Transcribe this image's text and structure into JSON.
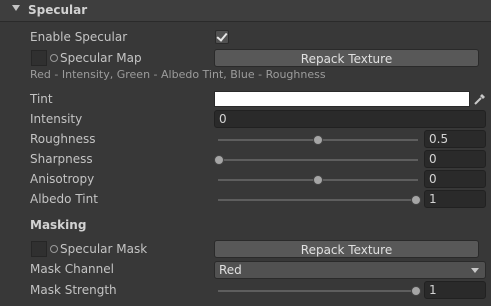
{
  "section": {
    "title": "Specular"
  },
  "enable_specular": {
    "label": "Enable Specular",
    "checked": true
  },
  "specular_map": {
    "label": "Specular Map",
    "button": "Repack Texture",
    "help": "Red - Intensity, Green - Albedo Tint, Blue - Roughness"
  },
  "tint": {
    "label": "Tint",
    "color": "#ffffff"
  },
  "intensity": {
    "label": "Intensity",
    "value": "0"
  },
  "roughness": {
    "label": "Roughness",
    "value": "0.5",
    "fraction": 0.5
  },
  "sharpness": {
    "label": "Sharpness",
    "value": "0",
    "fraction": 0
  },
  "anisotropy": {
    "label": "Anisotropy",
    "value": "0",
    "fraction": 0.5
  },
  "albedo_tint": {
    "label": "Albedo Tint",
    "value": "1",
    "fraction": 1
  },
  "masking": {
    "title": "Masking"
  },
  "specular_mask": {
    "label": "Specular Mask",
    "button": "Repack Texture"
  },
  "mask_channel": {
    "label": "Mask Channel",
    "value": "Red"
  },
  "mask_strength": {
    "label": "Mask Strength",
    "value": "1",
    "fraction": 1
  }
}
